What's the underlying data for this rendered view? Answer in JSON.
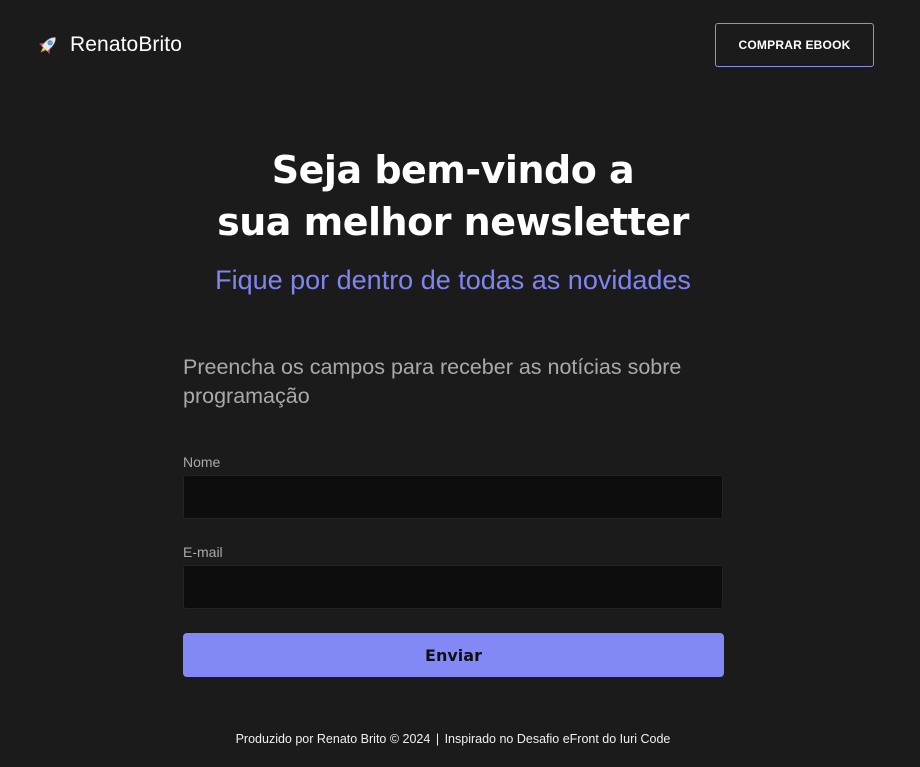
{
  "header": {
    "brand_icon": "rocket-icon",
    "brand_name": "RenatoBrito",
    "buy_button_label": "COMPRAR EBOOK",
    "accent_color": "#8b8fe6"
  },
  "hero": {
    "title_line1": "Seja bem-vindo a",
    "title_line2": "sua melhor newsletter",
    "subtitle": "Fique por dentro de todas as novidades",
    "subtitle_color": "#7f85f0"
  },
  "form": {
    "intro": "Preencha os campos para receber as notícias sobre programação",
    "fields": [
      {
        "label": "Nome",
        "value": "",
        "placeholder": ""
      },
      {
        "label": "E-mail",
        "value": "",
        "placeholder": ""
      }
    ],
    "submit_label": "Enviar",
    "submit_color": "#8289f5"
  },
  "footer": {
    "left_text": "Produzido por Renato Brito © 2024",
    "separator": "|",
    "right_text": "Inspirado no Desafio eFront do Iuri Code"
  },
  "colors": {
    "background": "#1b1b1c",
    "input_background": "#0d0d0e",
    "muted_text": "#a9a9ad"
  }
}
